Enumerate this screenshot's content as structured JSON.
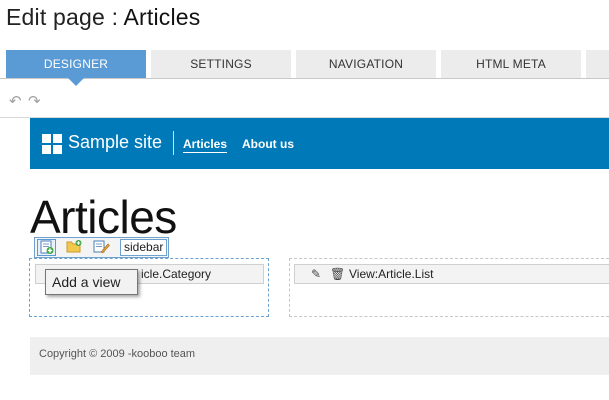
{
  "header": {
    "title_prefix": "Edit page : ",
    "title_name": "Articles"
  },
  "tabs": [
    {
      "label": "DESIGNER",
      "active": true
    },
    {
      "label": "SETTINGS",
      "active": false
    },
    {
      "label": "NAVIGATION",
      "active": false
    },
    {
      "label": "HTML META",
      "active": false
    }
  ],
  "history": {
    "undo_icon": "undo-icon",
    "redo_icon": "redo-icon",
    "undo_glyph": "↶",
    "redo_glyph": "↷"
  },
  "preview": {
    "site_name": "Sample site",
    "nav": [
      {
        "label": "Articles",
        "current": true
      },
      {
        "label": "About us",
        "current": false
      }
    ],
    "heading": "Articles",
    "colors": {
      "header_bg": "#0079b8",
      "zone_border": "#6fa1cf",
      "tab_active": "#5b9bd5"
    },
    "left_zone": {
      "view_label_visible": "icle.Category",
      "toolbar": {
        "buttons": [
          "add-view-icon",
          "add-folder-icon",
          "edit-icon"
        ],
        "name": "sidebar"
      },
      "tooltip": "Add a view"
    },
    "right_zone": {
      "view_label": "View:Article.List",
      "edit_glyph": "✎",
      "delete_glyph": "🗑"
    },
    "footer": "Copyright © 2009 -kooboo team"
  }
}
